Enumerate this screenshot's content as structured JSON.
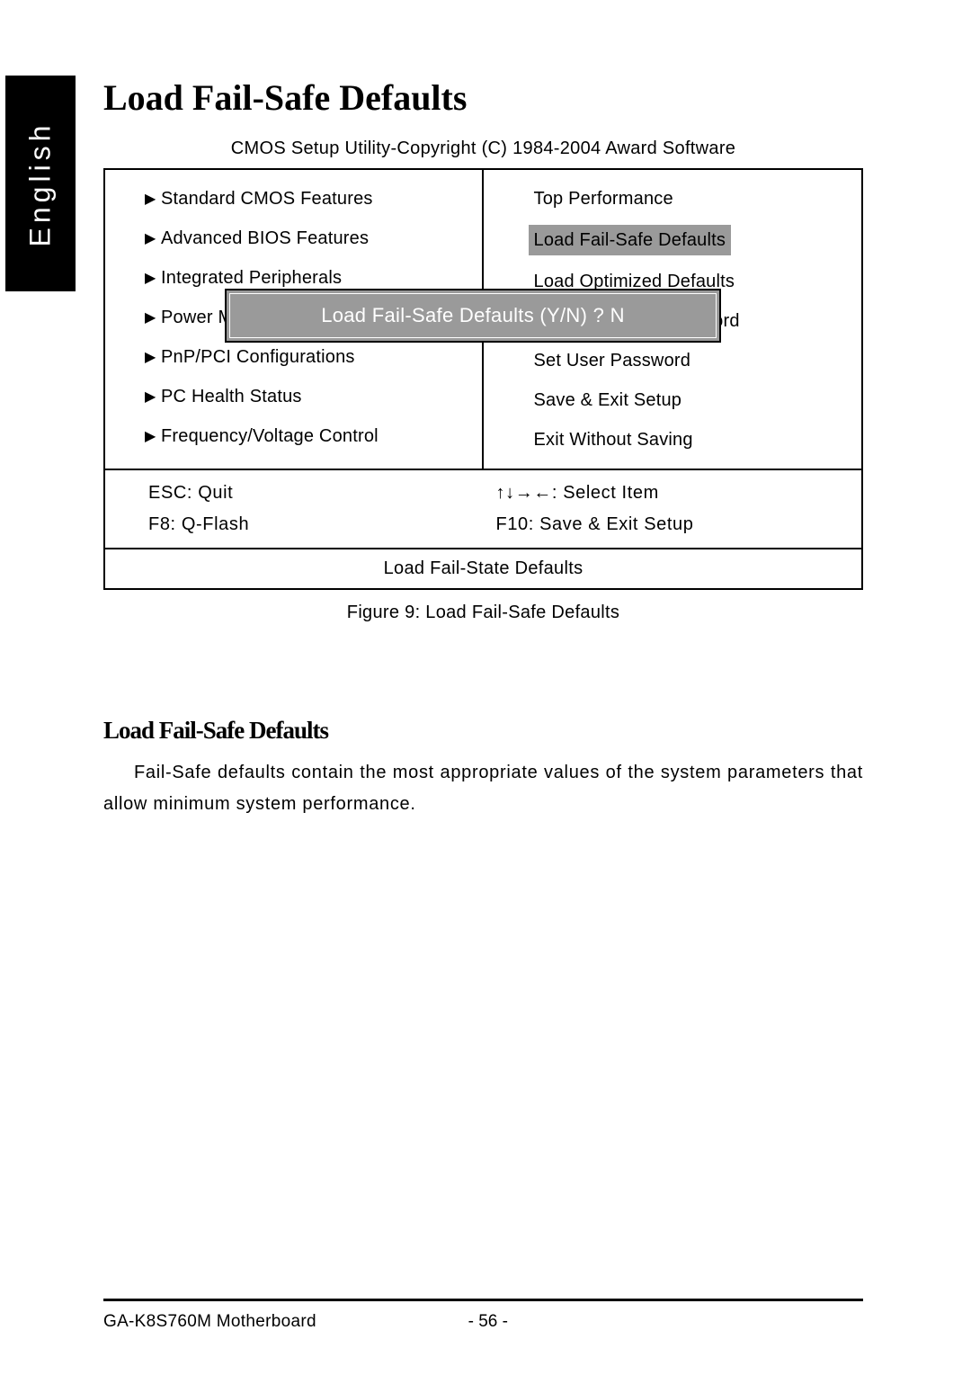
{
  "language_tab": "English",
  "section_title": "Load Fail-Safe Defaults",
  "bios": {
    "title": "CMOS Setup Utility-Copyright (C) 1984-2004 Award Software",
    "left_menu": [
      "Standard CMOS Features",
      "Advanced BIOS Features",
      "Integrated Peripherals",
      "Power Management Setup",
      "PnP/PCI Configurations",
      "PC Health Status",
      "Frequency/Voltage Control"
    ],
    "right_menu": [
      "Top Performance",
      "Load Fail-Safe Defaults",
      "Load Optimized Defaults",
      "Set Supervisor Password",
      "Set User Password",
      "Save & Exit Setup",
      "Exit Without Saving"
    ],
    "right_highlight_index": 1,
    "dialog_text": "Load Fail-Safe Defaults (Y/N) ? N",
    "help": {
      "esc": "ESC: Quit",
      "arrows": "↑↓→←: Select Item",
      "f8": "F8: Q-Flash",
      "f10": "F10: Save & Exit Setup"
    },
    "status": "Load Fail-State Defaults"
  },
  "figure_caption": "Figure 9: Load Fail-Safe Defaults",
  "sub_title": "Load Fail-Safe Defaults",
  "body_text": "Fail-Safe defaults contain the most appropriate values of the system parameters that allow minimum system performance.",
  "footer": {
    "product": "GA-K8S760M Motherboard",
    "page": "- 56 -"
  }
}
